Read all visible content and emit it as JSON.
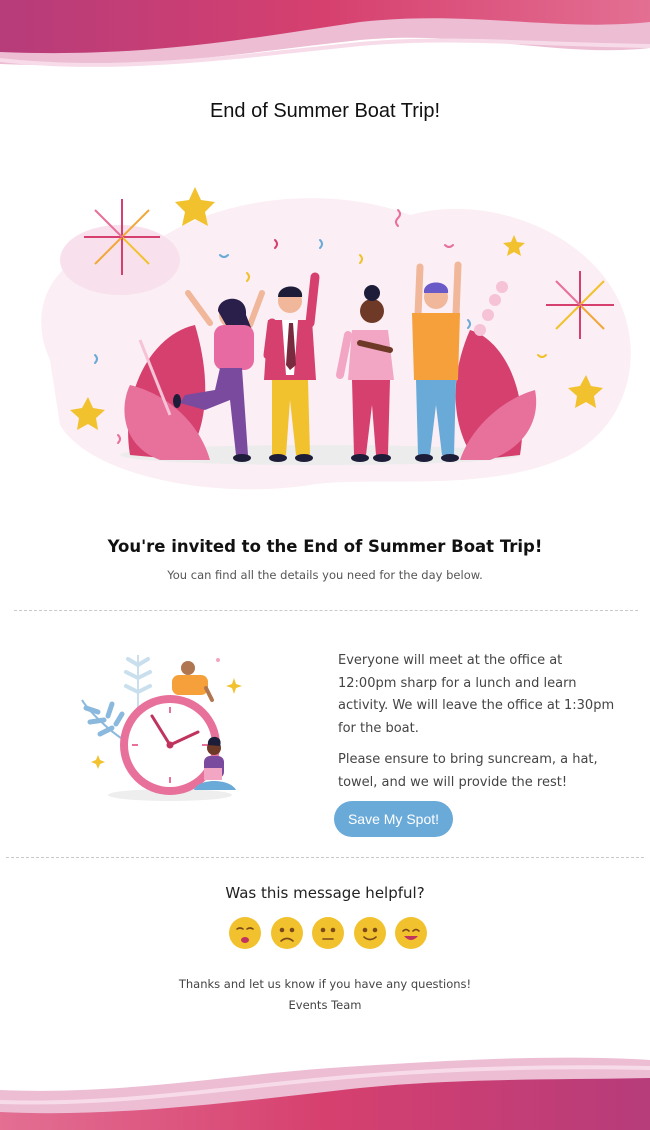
{
  "header": {
    "title": "End of Summer Boat Trip!"
  },
  "invite": {
    "heading": "You're invited to the End of Summer Boat Trip!",
    "subtitle": "You can find all the details you need for the day below."
  },
  "details": {
    "paragraph_1": "Everyone will meet at the office at 12:00pm sharp for a lunch and learn activity. We will leave the office at 1:30pm for the boat.",
    "paragraph_2": "Please ensure to bring suncream, a hat, towel, and we will provide the rest!",
    "cta_label": "Save My Spot!"
  },
  "feedback": {
    "question": "Was this message helpful?",
    "ratings": [
      "very-sad-face-icon",
      "sad-face-icon",
      "neutral-face-icon",
      "slight-smile-face-icon",
      "happy-face-icon"
    ]
  },
  "footer": {
    "thanks": "Thanks and let us know if you have any questions!",
    "signoff": "Events Team"
  },
  "colors": {
    "wave_dark": "#b83a78",
    "wave_light": "#e7a3c4",
    "accent_pink": "#d6406f",
    "cta_blue": "#6aaad9",
    "emoji_yellow": "#f2c12e",
    "divider": "#c9c9c9"
  }
}
